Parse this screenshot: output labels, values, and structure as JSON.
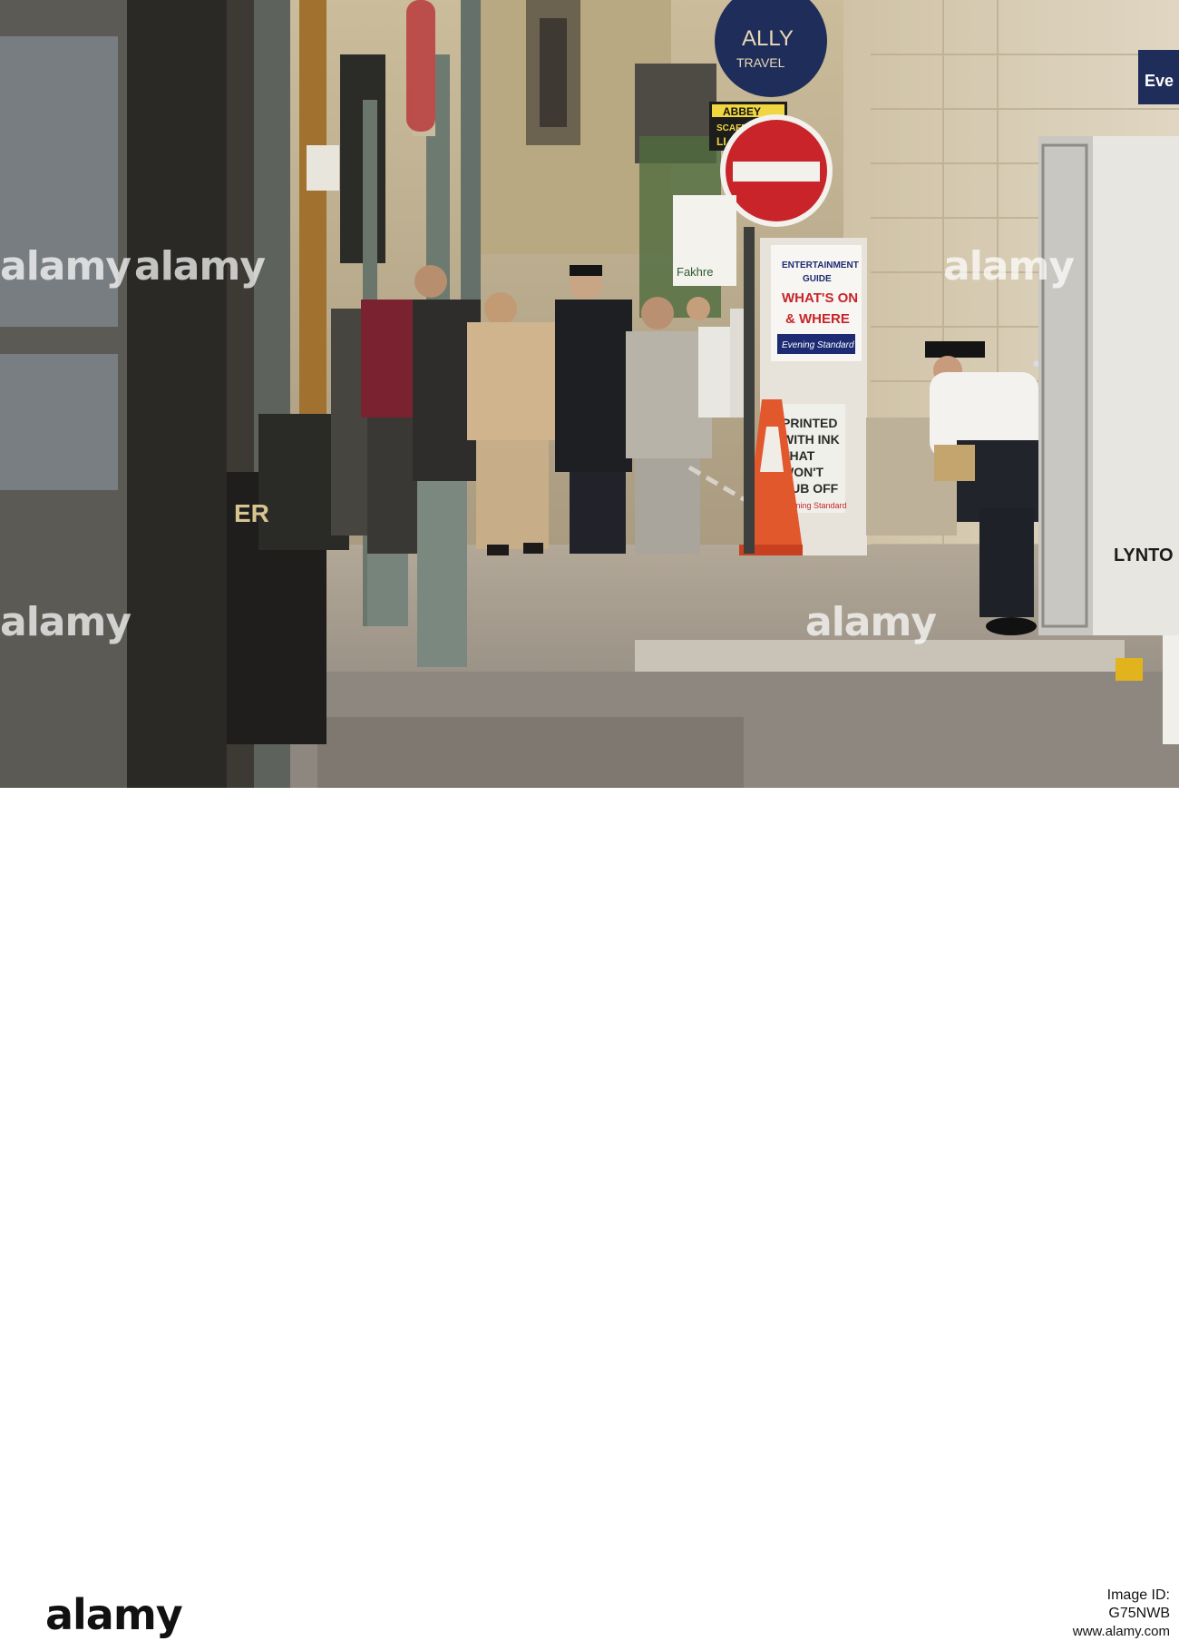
{
  "photo": {
    "signs": {
      "travel_top": "ALLY",
      "travel_bottom": "TRAVEL",
      "abbey_1": "ABBEY",
      "abbey_2": "SCAFF",
      "abbey_3": "LI",
      "fakhr": "Fakhre",
      "kiosk_1": "ENTERTAINMENT",
      "kiosk_2": "GUIDE",
      "kiosk_3": "WHAT'S ON",
      "kiosk_4": "& WHERE",
      "kiosk_5": "Evening Standard",
      "board_1": "PRINTED",
      "board_2": "WITH INK",
      "board_3": "THAT",
      "board_4": "WON'T",
      "board_5": "RUB OFF",
      "board_6": "Evening Standard",
      "bin_text": "ER",
      "van_text": "LYNTO",
      "top_right_fragment": "Eve"
    }
  },
  "watermark": "alamy",
  "footer": {
    "logo": "alamy",
    "image_id": "Image ID: G75NWB",
    "url": "www.alamy.com"
  },
  "colors": {
    "sky_facade": "#cdbf9f",
    "pavement": "#a79d90",
    "road": "#8f8880",
    "sign_red": "#c8242a",
    "travel_blue": "#1f2d5a"
  }
}
